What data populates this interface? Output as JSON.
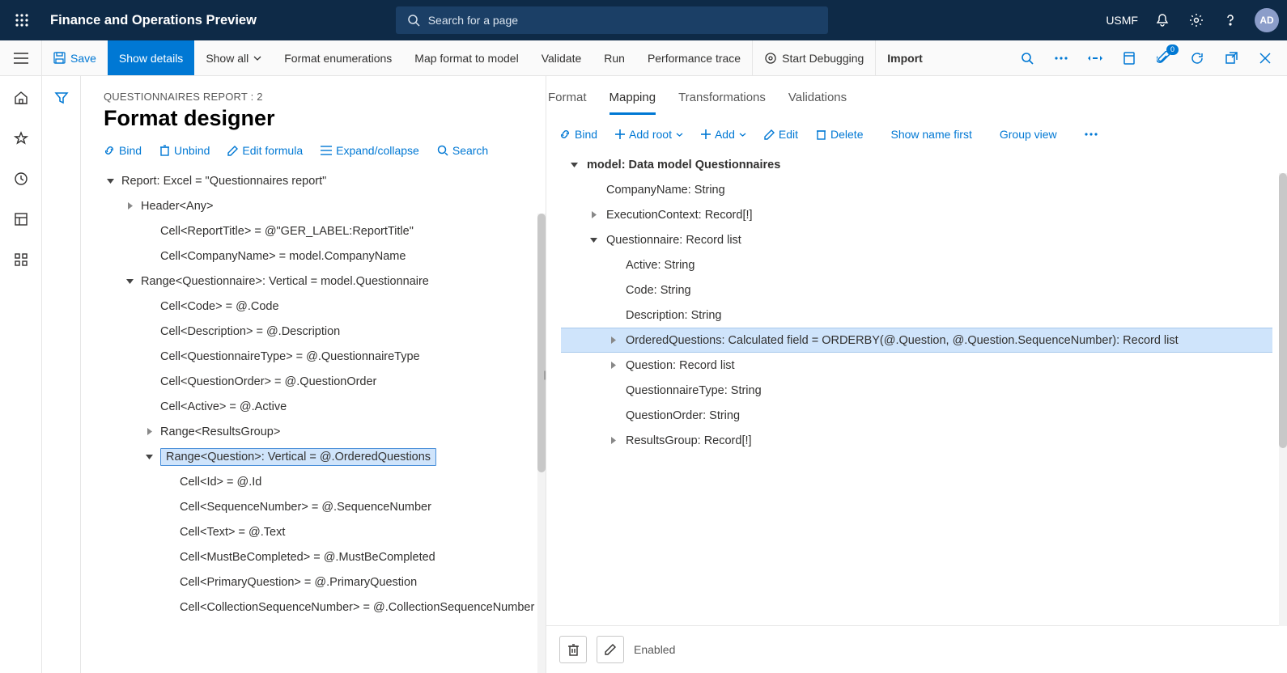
{
  "topbar": {
    "app_title": "Finance and Operations Preview",
    "search_placeholder": "Search for a page",
    "company": "USMF",
    "avatar": "AD"
  },
  "commands": {
    "save": "Save",
    "show_details": "Show details",
    "show_all": "Show all",
    "format_enum": "Format enumerations",
    "map_format": "Map format to model",
    "validate": "Validate",
    "run": "Run",
    "perf_trace": "Performance trace",
    "start_debug": "Start Debugging",
    "import": "Import",
    "attach_badge": "0"
  },
  "page": {
    "breadcrumb": "QUESTIONNAIRES REPORT : 2",
    "title": "Format designer"
  },
  "left_toolbar": {
    "bind": "Bind",
    "unbind": "Unbind",
    "edit_formula": "Edit formula",
    "expand_collapse": "Expand/collapse",
    "search": "Search"
  },
  "left_tree": [
    {
      "depth": 0,
      "toggle": "down",
      "text": "Report: Excel = \"Questionnaires report\""
    },
    {
      "depth": 1,
      "toggle": "right",
      "text": "Header<Any>"
    },
    {
      "depth": 2,
      "toggle": "",
      "text": "Cell<ReportTitle> = @\"GER_LABEL:ReportTitle\""
    },
    {
      "depth": 2,
      "toggle": "",
      "text": "Cell<CompanyName> = model.CompanyName"
    },
    {
      "depth": 1,
      "toggle": "down",
      "text": "Range<Questionnaire>: Vertical = model.Questionnaire"
    },
    {
      "depth": 2,
      "toggle": "",
      "text": "Cell<Code> = @.Code"
    },
    {
      "depth": 2,
      "toggle": "",
      "text": "Cell<Description> = @.Description"
    },
    {
      "depth": 2,
      "toggle": "",
      "text": "Cell<QuestionnaireType> = @.QuestionnaireType"
    },
    {
      "depth": 2,
      "toggle": "",
      "text": "Cell<QuestionOrder> = @.QuestionOrder"
    },
    {
      "depth": 2,
      "toggle": "",
      "text": "Cell<Active> = @.Active"
    },
    {
      "depth": 2,
      "toggle": "right",
      "text": "Range<ResultsGroup>"
    },
    {
      "depth": 2,
      "toggle": "down",
      "text": "Range<Question>: Vertical = @.OrderedQuestions",
      "selected": true
    },
    {
      "depth": 3,
      "toggle": "",
      "text": "Cell<Id> = @.Id"
    },
    {
      "depth": 3,
      "toggle": "",
      "text": "Cell<SequenceNumber> = @.SequenceNumber"
    },
    {
      "depth": 3,
      "toggle": "",
      "text": "Cell<Text> = @.Text"
    },
    {
      "depth": 3,
      "toggle": "",
      "text": "Cell<MustBeCompleted> = @.MustBeCompleted"
    },
    {
      "depth": 3,
      "toggle": "",
      "text": "Cell<PrimaryQuestion> = @.PrimaryQuestion"
    },
    {
      "depth": 3,
      "toggle": "",
      "text": "Cell<CollectionSequenceNumber> = @.CollectionSequenceNumber"
    }
  ],
  "tabs": {
    "format": "Format",
    "mapping": "Mapping",
    "transformations": "Transformations",
    "validations": "Validations"
  },
  "right_toolbar": {
    "bind": "Bind",
    "add_root": "Add root",
    "add": "Add",
    "edit": "Edit",
    "delete": "Delete",
    "show_name_first": "Show name first",
    "group_view": "Group view"
  },
  "right_tree": [
    {
      "depth": 0,
      "toggle": "down",
      "text": "model: Data model Questionnaires",
      "bold": true
    },
    {
      "depth": 1,
      "toggle": "",
      "text": "CompanyName: String"
    },
    {
      "depth": 1,
      "toggle": "right",
      "text": "ExecutionContext: Record[!]"
    },
    {
      "depth": 1,
      "toggle": "down",
      "text": "Questionnaire: Record list"
    },
    {
      "depth": 2,
      "toggle": "",
      "text": "Active: String"
    },
    {
      "depth": 2,
      "toggle": "",
      "text": "Code: String"
    },
    {
      "depth": 2,
      "toggle": "",
      "text": "Description: String"
    },
    {
      "depth": 2,
      "toggle": "right",
      "text": "OrderedQuestions: Calculated field = ORDERBY(@.Question, @.Question.SequenceNumber): Record list",
      "selected": true
    },
    {
      "depth": 2,
      "toggle": "right",
      "text": "Question: Record list"
    },
    {
      "depth": 2,
      "toggle": "",
      "text": "QuestionnaireType: String"
    },
    {
      "depth": 2,
      "toggle": "",
      "text": "QuestionOrder: String"
    },
    {
      "depth": 2,
      "toggle": "right",
      "text": "ResultsGroup: Record[!]"
    }
  ],
  "footer": {
    "enabled": "Enabled"
  }
}
